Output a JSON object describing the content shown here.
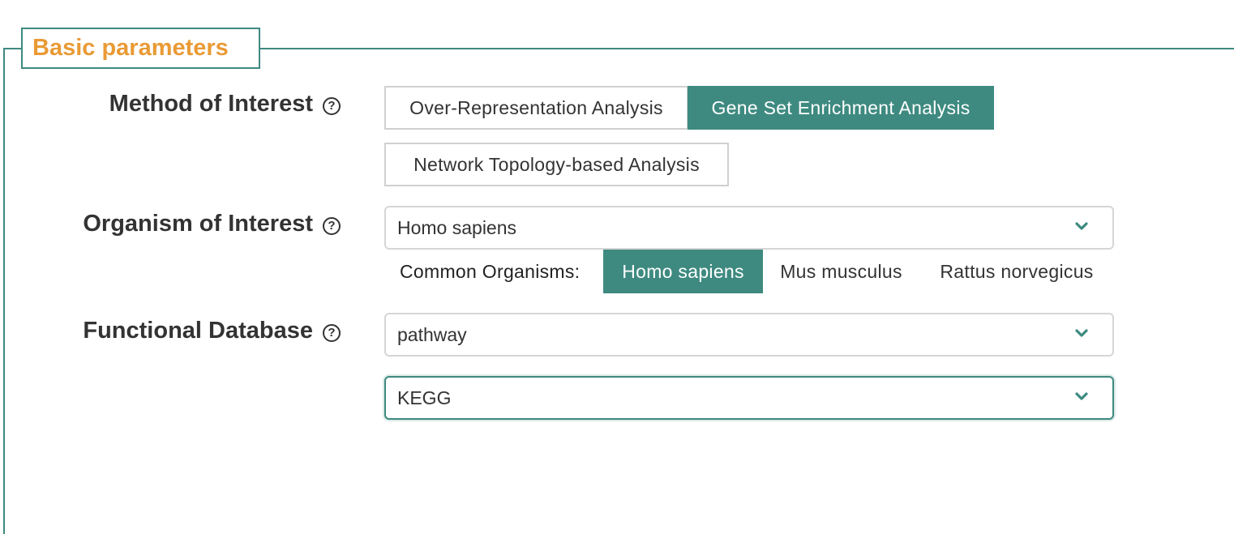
{
  "section": {
    "legend": "Basic parameters"
  },
  "method": {
    "label": "Method of Interest",
    "help_icon": "question-circle-icon",
    "options": [
      {
        "label": "Over-Representation Analysis",
        "selected": false
      },
      {
        "label": "Gene Set Enrichment Analysis",
        "selected": true
      },
      {
        "label": "Network Topology-based Analysis",
        "selected": false
      }
    ]
  },
  "organism": {
    "label": "Organism of Interest",
    "help_icon": "question-circle-icon",
    "selected_value": "Homo sapiens",
    "common_label": "Common Organisms:",
    "common": [
      {
        "label": "Homo sapiens",
        "selected": true
      },
      {
        "label": "Mus musculus",
        "selected": false
      },
      {
        "label": "Rattus norvegicus",
        "selected": false
      }
    ]
  },
  "database": {
    "label": "Functional Database",
    "help_icon": "question-circle-icon",
    "category_value": "pathway",
    "database_value": "KEGG"
  },
  "colors": {
    "accent": "#3e8a80",
    "legend_text": "#e99a35"
  }
}
